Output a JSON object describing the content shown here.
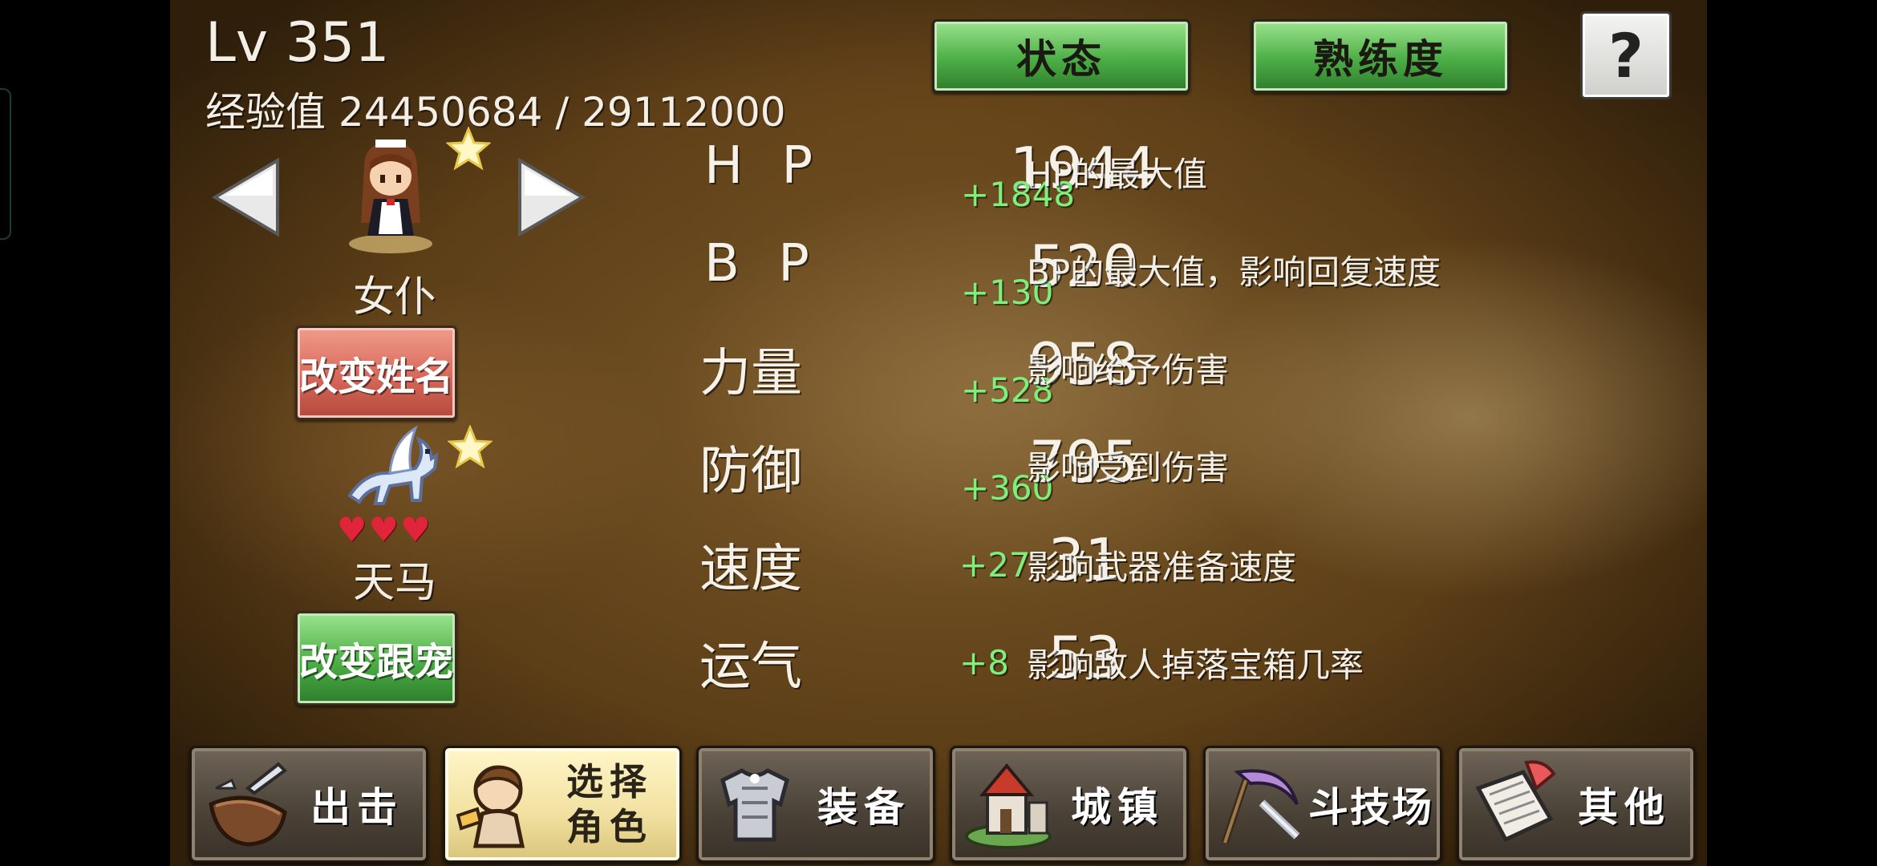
{
  "player": {
    "level_text": "Lv 351",
    "exp_label": "经验值",
    "exp_current": "24450684",
    "exp_separator": "/",
    "exp_max": "29112000"
  },
  "tabs": {
    "status": "状态",
    "proficiency": "熟练度",
    "help": "?"
  },
  "character": {
    "name": "女仆",
    "rename_button": "改变姓名"
  },
  "pet": {
    "name": "天马",
    "hearts": "♥♥♥",
    "change_button": "改变跟宠"
  },
  "stats": [
    {
      "label": "H P",
      "value": "1944",
      "bonus": "+1848",
      "desc": "HP的最大值"
    },
    {
      "label": "B P",
      "value": "520",
      "bonus": "+130",
      "desc": "BP的最大值，影响回复速度"
    },
    {
      "label": "力量",
      "value": "958",
      "bonus": "+528",
      "desc": "影响给予伤害"
    },
    {
      "label": "防御",
      "value": "795",
      "bonus": "+360",
      "desc": "影响受到伤害"
    },
    {
      "label": "速度",
      "value": "31",
      "bonus": "+27",
      "desc": "影响武器准备速度"
    },
    {
      "label": "运气",
      "value": "53",
      "bonus": "+8",
      "desc": "影响敌人掉落宝箱几率"
    }
  ],
  "nav": [
    {
      "label": "出击",
      "icon": "pot-icon"
    },
    {
      "label": "选择角色",
      "label_line1": "选择",
      "label_line2": "角色",
      "icon": "character-icon"
    },
    {
      "label": "装备",
      "icon": "armor-icon"
    },
    {
      "label": "城镇",
      "icon": "town-icon"
    },
    {
      "label": "斗技场",
      "icon": "arena-scythe-icon"
    },
    {
      "label": "其他",
      "icon": "scroll-icon"
    }
  ],
  "colors": {
    "bonus_green": "#7cf07a",
    "button_green": "#4cae46",
    "button_red": "#d6685a",
    "heart_red": "#e0243a"
  }
}
